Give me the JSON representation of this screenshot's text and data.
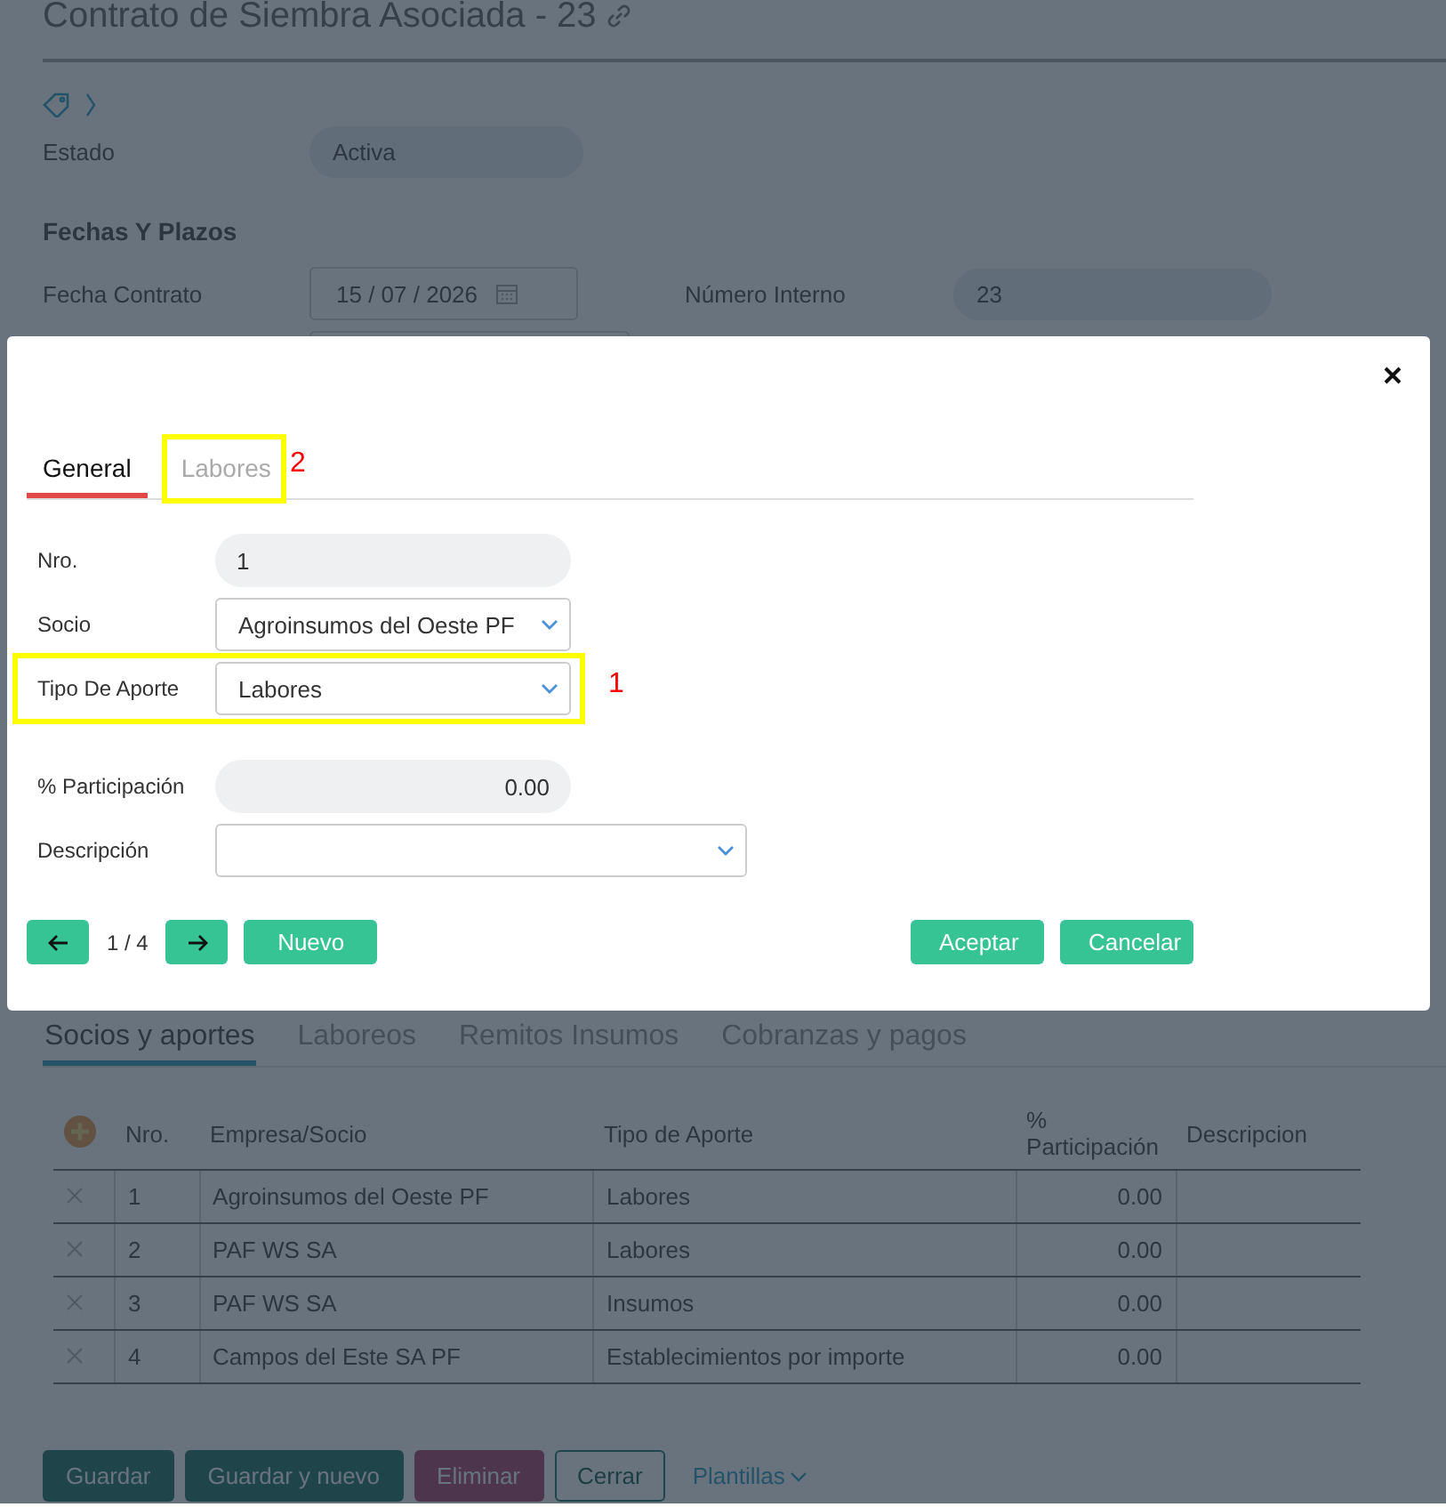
{
  "page": {
    "title": "Contrato de Siembra Asociada - 23",
    "estado_label": "Estado",
    "estado_value": "Activa",
    "section_title": "Fechas Y Plazos",
    "fecha_label": "Fecha Contrato",
    "fecha_value": "15 / 07 / 2026",
    "numero_label": "Número Interno",
    "numero_value": "23"
  },
  "tabs": [
    {
      "label": "Socios y aportes",
      "selected": true
    },
    {
      "label": "Laboreos",
      "selected": false
    },
    {
      "label": "Remitos Insumos",
      "selected": false
    },
    {
      "label": "Cobranzas y pagos",
      "selected": false
    }
  ],
  "table": {
    "columns": [
      "Nro.",
      "Empresa/Socio",
      "Tipo de Aporte",
      "% Participación",
      "Descripcion"
    ],
    "rows": [
      [
        "1",
        "Agroinsumos del Oeste PF",
        "Labores",
        "0.00"
      ],
      [
        "2",
        "PAF WS SA",
        "Labores",
        "0.00"
      ],
      [
        "3",
        "PAF WS SA",
        "Insumos",
        "0.00"
      ],
      [
        "4",
        "Campos del Este SA PF",
        "Establecimientos por importe",
        "0.00"
      ]
    ]
  },
  "actions": [
    {
      "label": "Guardar",
      "kind": "primary"
    },
    {
      "label": "Guardar y nuevo",
      "kind": "primary"
    },
    {
      "label": "Eliminar",
      "kind": "danger"
    },
    {
      "label": "Cerrar",
      "kind": "outline"
    },
    {
      "label": "Plantillas",
      "kind": "link"
    }
  ],
  "dialog": {
    "tabs": [
      {
        "label": "General",
        "selected": true
      },
      {
        "label": "Labores",
        "selected": false,
        "annotation": "2"
      }
    ],
    "fields": [
      {
        "label": "Nro.",
        "value": "1",
        "kind": "readonly"
      },
      {
        "label": "Socio",
        "value": "Agroinsumos del Oeste PF",
        "kind": "select"
      },
      {
        "label": "Tipo De Aporte",
        "value": "Labores",
        "kind": "select",
        "annotation": "1"
      },
      {
        "label": "% Participación",
        "value": "0.00",
        "kind": "number"
      },
      {
        "label": "Descripción",
        "kind": "select-wide"
      }
    ],
    "pager": "1 / 4",
    "new_button": "Nuevo",
    "accept_button": "Aceptar",
    "cancel_button": "Cancelar"
  }
}
